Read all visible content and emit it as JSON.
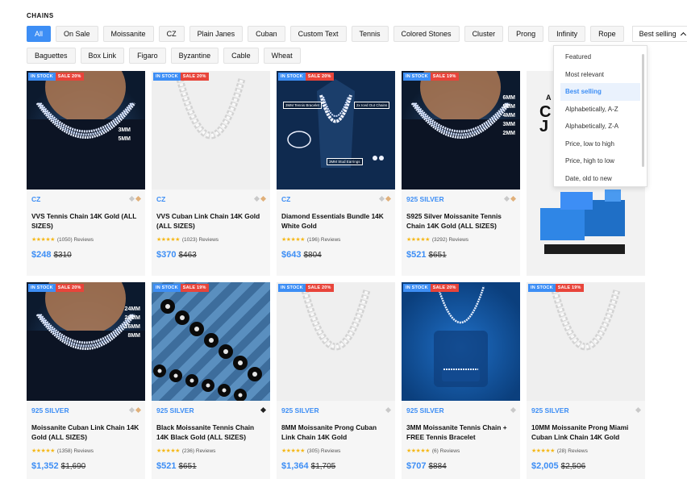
{
  "section_label": "CHAINS",
  "filters_row1": [
    "All",
    "On Sale",
    "Moissanite",
    "CZ",
    "Plain Janes",
    "Cuban",
    "Custom Text",
    "Tennis",
    "Colored Stones",
    "Cluster",
    "Prong",
    "Infinity",
    "Rope"
  ],
  "filters_row2": [
    "Baguettes",
    "Box Link",
    "Figaro",
    "Byzantine",
    "Cable",
    "Wheat"
  ],
  "active_filter": "All",
  "sort": {
    "label": "Best selling",
    "options": [
      "Featured",
      "Most relevant",
      "Best selling",
      "Alphabetically, A-Z",
      "Alphabetically, Z-A",
      "Price, low to high",
      "Price, high to low",
      "Date, old to new"
    ],
    "selected": "Best selling"
  },
  "colors": {
    "accent": "#3d8ef5",
    "sale": "#e8443a",
    "star": "#f5b818"
  },
  "badge_stock": "IN STOCK",
  "products": [
    {
      "badge_sale": "SALE 20%",
      "category": "CZ",
      "title": "VVS Tennis Chain 14K Gold (ALL SIZES)",
      "reviews": "(1050) Reviews",
      "price": "$248",
      "old_price": "$310",
      "img": "dark",
      "sizes": [
        "3MM",
        "5MM"
      ]
    },
    {
      "badge_sale": "SALE 20%",
      "category": "CZ",
      "title": "VVS Cuban Link Chain 14K Gold (ALL SIZES)",
      "reviews": "(1023) Reviews",
      "price": "$370",
      "old_price": "$463",
      "img": "light",
      "sizes": []
    },
    {
      "badge_sale": "SALE 20%",
      "category": "CZ",
      "title": "Diamond Essentials Bundle 14K White Gold",
      "reviews": "(196) Reviews",
      "price": "$643",
      "old_price": "$804",
      "img": "bundle",
      "sizes": [],
      "callouts": [
        "3MM Tennis Bracelet",
        "2x Iced Out Chains",
        "3MM Stud Earrings"
      ]
    },
    {
      "badge_sale": "SALE 19%",
      "category": "925 SILVER",
      "title": "S925 Silver Moissanite Tennis Chain 14K Gold (ALL SIZES)",
      "reviews": "(3292) Reviews",
      "price": "$521",
      "old_price": "$651",
      "img": "dark",
      "sizes": [
        "6MM",
        "5MM",
        "4MM",
        "3MM",
        "2MM"
      ]
    },
    {
      "badge_sale": "SALE 20%",
      "category": "925 SILVER",
      "title": "Moissanite Cuban Link Chain 14K Gold (ALL SIZES)",
      "reviews": "(1358) Reviews",
      "price": "$1,352",
      "old_price": "$1,690",
      "img": "dark",
      "sizes": [
        "24MM",
        "20MM",
        "16MM",
        "8MM"
      ]
    },
    {
      "badge_sale": "SALE 19%",
      "category": "925 SILVER",
      "title": "Black Moissanite Tennis Chain 14K Black Gold (ALL SIZES)",
      "reviews": "(236) Reviews",
      "price": "$521",
      "old_price": "$651",
      "img": "ice",
      "sizes": []
    },
    {
      "badge_sale": "SALE 20%",
      "category": "925 SILVER",
      "title": "8MM Moissanite Prong Cuban Link Chain 14K Gold",
      "reviews": "(305) Reviews",
      "price": "$1,364",
      "old_price": "$1,705",
      "img": "light",
      "sizes": []
    },
    {
      "badge_sale": "SALE 20%",
      "category": "925 SILVER",
      "title": "3MM Moissanite Tennis Chain + FREE Tennis Bracelet",
      "reviews": "(6) Reviews",
      "price": "$707",
      "old_price": "$884",
      "img": "blue",
      "sizes": []
    },
    {
      "badge_sale": "SALE 19%",
      "category": "925 SILVER",
      "title": "10MM Moissanite Prong Miami Cuban Link Chain 14K Gold",
      "reviews": "(28) Reviews",
      "price": "$2,005",
      "old_price": "$2,506",
      "img": "light",
      "sizes": []
    }
  ],
  "promo": {
    "text_lines": [
      "A",
      "C",
      "J"
    ]
  }
}
